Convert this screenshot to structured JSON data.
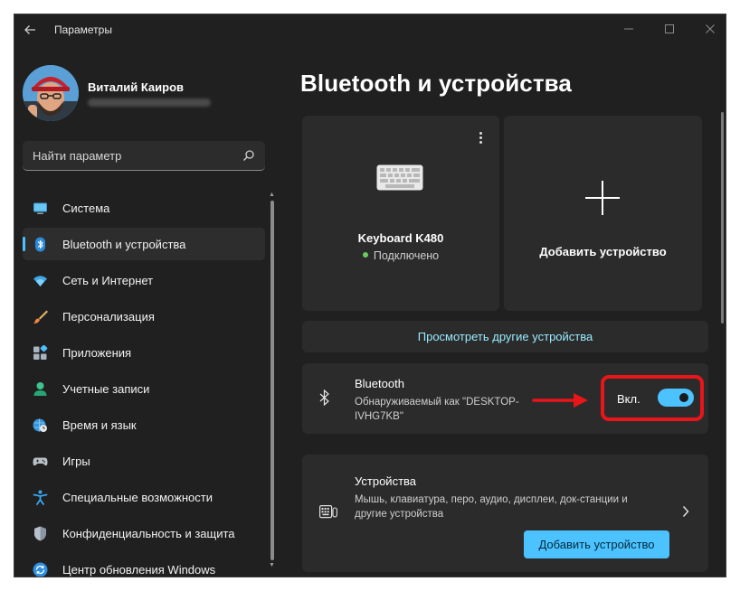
{
  "window": {
    "title": "Параметры"
  },
  "profile": {
    "name": "Виталий Каиров"
  },
  "search": {
    "placeholder": "Найти параметр"
  },
  "sidebar": {
    "items": [
      {
        "label": "Система",
        "icon": "monitor-icon"
      },
      {
        "label": "Bluetooth и устройства",
        "icon": "bluetooth-icon",
        "active": true
      },
      {
        "label": "Сеть и Интернет",
        "icon": "wifi-icon"
      },
      {
        "label": "Персонализация",
        "icon": "brush-icon"
      },
      {
        "label": "Приложения",
        "icon": "apps-icon"
      },
      {
        "label": "Учетные записи",
        "icon": "person-icon"
      },
      {
        "label": "Время и язык",
        "icon": "globe-clock-icon"
      },
      {
        "label": "Игры",
        "icon": "gamepad-icon"
      },
      {
        "label": "Специальные возможности",
        "icon": "accessibility-icon"
      },
      {
        "label": "Конфиденциальность и защита",
        "icon": "shield-icon"
      },
      {
        "label": "Центр обновления Windows",
        "icon": "update-icon"
      }
    ]
  },
  "main": {
    "title": "Bluetooth и устройства",
    "device_card": {
      "name": "Keyboard K480",
      "status": "Подключено"
    },
    "add_card": {
      "label": "Добавить устройство"
    },
    "view_more": "Просмотреть другие устройства",
    "bluetooth": {
      "title": "Bluetooth",
      "description": "Обнаруживаемый как \"DESKTOP-IVHG7KB\"",
      "toggle_label": "Вкл.",
      "enabled": true
    },
    "devices": {
      "title": "Устройства",
      "description": "Мышь, клавиатура, перо, аудио, дисплеи, док-станции и другие устройства",
      "button": "Добавить устройство"
    }
  },
  "colors": {
    "accent": "#4cc2ff",
    "link": "#99ebff",
    "annotation": "#e8151b",
    "status_ok": "#6ccb5f"
  }
}
